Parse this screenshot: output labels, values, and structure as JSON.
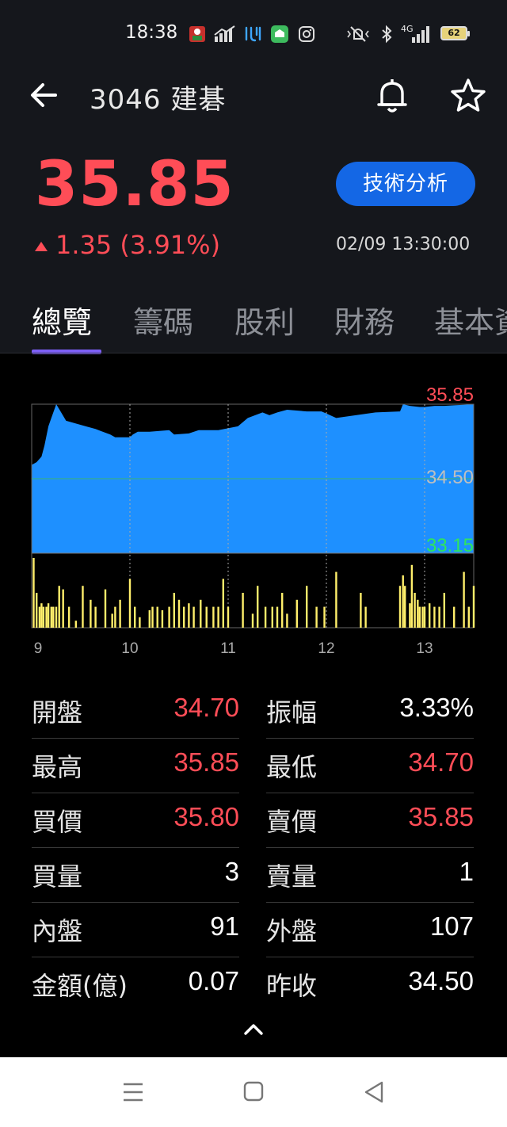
{
  "status_bar": {
    "time": "18:38",
    "network": "4G",
    "battery": "62",
    "icons": [
      "app-notification-icon",
      "signal-stats-icon",
      "app-icon",
      "line-icon",
      "instagram-icon",
      "mute-icon",
      "bluetooth-icon",
      "cellular-signal-icon",
      "battery-icon"
    ]
  },
  "header": {
    "title": "3046 建碁",
    "back_icon": "arrow-left-icon",
    "bell_icon": "bell-icon",
    "star_icon": "star-icon"
  },
  "quote": {
    "price": "35.85",
    "change": "1.35 (3.91%)",
    "direction": "up",
    "timestamp": "02/09 13:30:00",
    "tech_button_label": "技術分析"
  },
  "tabs": [
    {
      "label": "總覽",
      "active": true
    },
    {
      "label": "籌碼",
      "active": false
    },
    {
      "label": "股利",
      "active": false
    },
    {
      "label": "財務",
      "active": false
    },
    {
      "label": "基本資料",
      "active": false
    }
  ],
  "chart_data": {
    "type": "area",
    "y_labels": {
      "high": "35.85",
      "ref": "34.50",
      "low": "33.15"
    },
    "ylim": [
      33.15,
      35.85
    ],
    "reference": 34.5,
    "x_ticks": [
      "9",
      "10",
      "11",
      "12",
      "13"
    ],
    "x_tick_values": [
      9,
      10,
      11,
      12,
      13
    ],
    "xlim": [
      9,
      13.5
    ],
    "grid": true,
    "colors": {
      "area": "#1e90ff",
      "volume": "#ffef6b",
      "high_label": "#ff4d57",
      "ref_label": "#bfbfbf",
      "low_label": "#2ee65c",
      "ref_line": "#3cb371"
    },
    "price_series": {
      "x": [
        9.0,
        9.05,
        9.1,
        9.13,
        9.17,
        9.2,
        9.25,
        9.3,
        9.35,
        9.45,
        9.55,
        9.65,
        9.8,
        9.85,
        10.0,
        10.03,
        10.08,
        10.2,
        10.4,
        10.45,
        10.6,
        10.7,
        10.9,
        11.1,
        11.2,
        11.35,
        11.42,
        11.5,
        11.6,
        11.8,
        11.95,
        12.0,
        12.1,
        12.3,
        12.5,
        12.75,
        12.78,
        12.85,
        12.95,
        13.0,
        13.1,
        13.2,
        13.3,
        13.4,
        13.5
      ],
      "y": [
        34.75,
        34.8,
        34.9,
        35.1,
        35.45,
        35.6,
        35.85,
        35.7,
        35.55,
        35.5,
        35.45,
        35.4,
        35.3,
        35.25,
        35.25,
        35.3,
        35.35,
        35.35,
        35.38,
        35.3,
        35.32,
        35.38,
        35.38,
        35.45,
        35.6,
        35.7,
        35.65,
        35.7,
        35.75,
        35.72,
        35.72,
        35.68,
        35.6,
        35.65,
        35.7,
        35.72,
        35.85,
        35.82,
        35.8,
        35.8,
        35.82,
        35.82,
        35.83,
        35.84,
        35.85
      ]
    },
    "volume_series": {
      "x": [
        9.02,
        9.05,
        9.08,
        9.1,
        9.12,
        9.15,
        9.17,
        9.2,
        9.22,
        9.25,
        9.28,
        9.32,
        9.38,
        9.45,
        9.52,
        9.6,
        9.65,
        9.75,
        9.82,
        9.85,
        9.9,
        10.0,
        10.05,
        10.1,
        10.2,
        10.23,
        10.28,
        10.33,
        10.4,
        10.45,
        10.5,
        10.55,
        10.6,
        10.65,
        10.72,
        10.78,
        10.85,
        10.9,
        10.95,
        11.0,
        11.15,
        11.25,
        11.3,
        11.38,
        11.45,
        11.5,
        11.55,
        11.6,
        11.7,
        11.8,
        11.9,
        11.98,
        12.1,
        12.35,
        12.4,
        12.75,
        12.78,
        12.8,
        12.85,
        12.87,
        12.9,
        12.93,
        12.95,
        12.98,
        13.0,
        13.05,
        13.1,
        13.15,
        13.2,
        13.3,
        13.4,
        13.45,
        13.5
      ],
      "v": [
        1,
        0.5,
        0.3,
        0.35,
        0.3,
        0.3,
        0.35,
        0.3,
        0.3,
        0.3,
        0.6,
        0.55,
        0.3,
        0.1,
        0.6,
        0.4,
        0.3,
        0.55,
        0.2,
        0.3,
        0.4,
        0.7,
        0.3,
        0.15,
        0.25,
        0.3,
        0.3,
        0.25,
        0.3,
        0.5,
        0.4,
        0.3,
        0.35,
        0.3,
        0.4,
        0.3,
        0.3,
        0.3,
        0.7,
        0.3,
        0.5,
        0.2,
        0.6,
        0.3,
        0.3,
        0.3,
        0.5,
        0.2,
        0.4,
        0.6,
        0.3,
        0.3,
        0.8,
        0.5,
        0.3,
        0.6,
        0.75,
        0.6,
        0.35,
        0.9,
        0.5,
        0.4,
        0.3,
        0.3,
        0.3,
        0.35,
        0.3,
        0.3,
        0.5,
        0.3,
        0.8,
        0.3,
        0.6
      ],
      "ymax_scale": 100
    }
  },
  "stats": {
    "left": [
      {
        "label": "開盤",
        "value": "34.70",
        "color": "red"
      },
      {
        "label": "最高",
        "value": "35.85",
        "color": "red"
      },
      {
        "label": "買價",
        "value": "35.80",
        "color": "red"
      },
      {
        "label": "買量",
        "value": "3",
        "color": "white"
      },
      {
        "label": "內盤",
        "value": "91",
        "color": "white"
      },
      {
        "label": "金額(億)",
        "value": "0.07",
        "color": "white"
      }
    ],
    "right": [
      {
        "label": "振幅",
        "value": "3.33%",
        "color": "white"
      },
      {
        "label": "最低",
        "value": "34.70",
        "color": "red"
      },
      {
        "label": "賣價",
        "value": "35.85",
        "color": "red"
      },
      {
        "label": "賣量",
        "value": "1",
        "color": "white"
      },
      {
        "label": "外盤",
        "value": "107",
        "color": "white"
      },
      {
        "label": "昨收",
        "value": "34.50",
        "color": "white"
      }
    ]
  },
  "nav_bar": {
    "icons": [
      "menu-icon",
      "home-icon",
      "back-triangle-icon"
    ]
  }
}
